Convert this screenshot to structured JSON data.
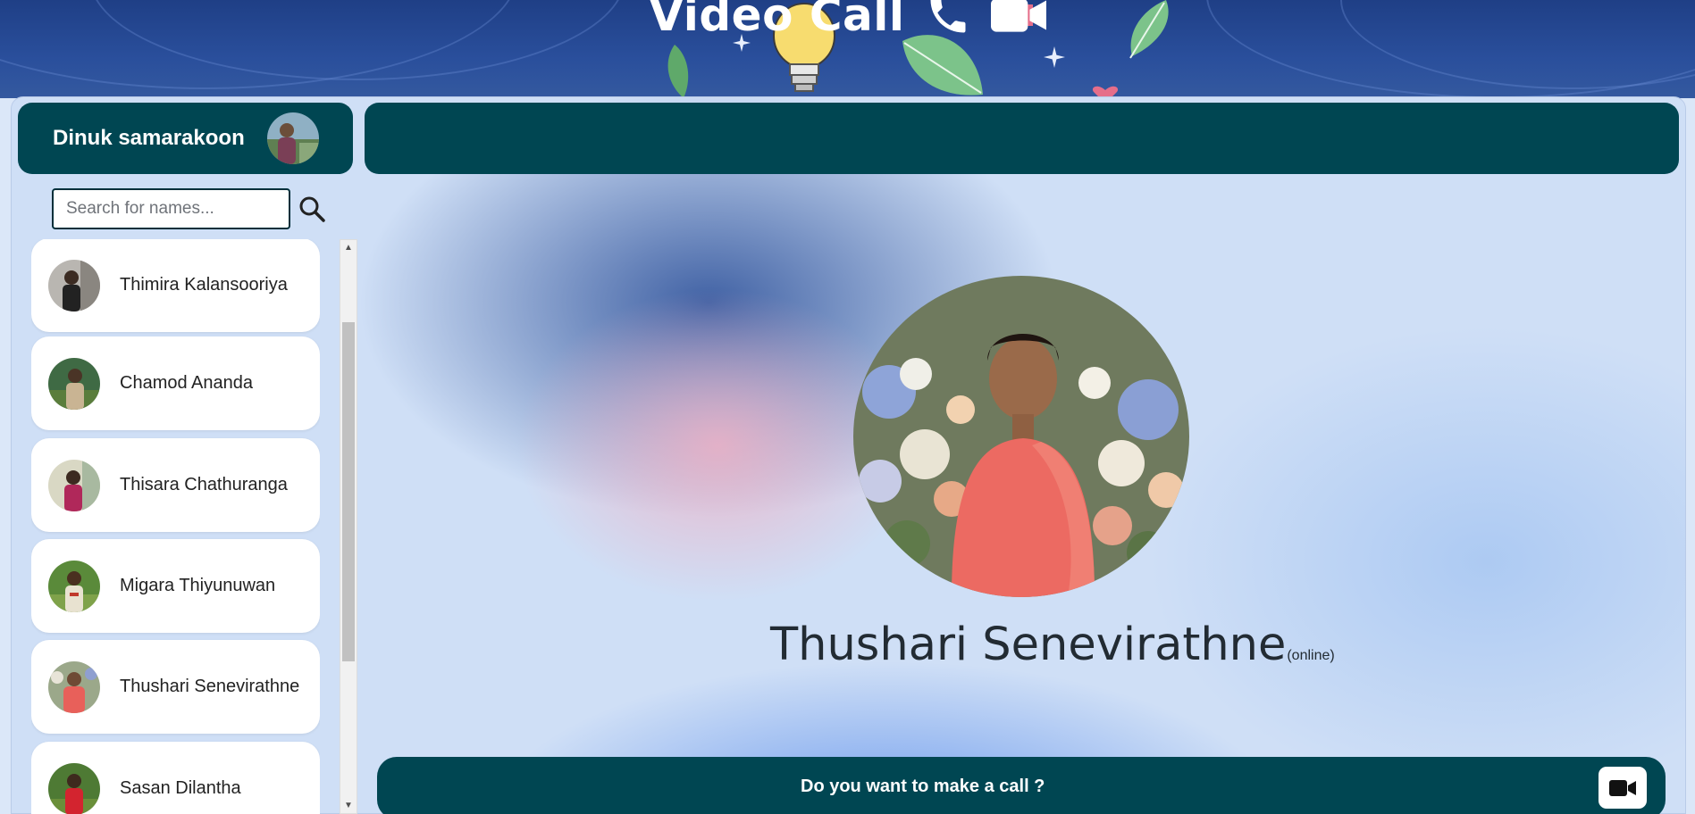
{
  "app": {
    "title": "Video Call",
    "title_icons": [
      "phone-icon",
      "video-camera-icon"
    ]
  },
  "current_user": {
    "name": "Dinuk samarakoon",
    "avatar": "avatar-photo"
  },
  "search": {
    "placeholder": "Search for names...",
    "value": "",
    "button_icon": "search-icon"
  },
  "contacts": [
    {
      "name": "Thimira Kalansooriya",
      "avatar": "avatar-photo"
    },
    {
      "name": "Chamod Ananda",
      "avatar": "avatar-photo"
    },
    {
      "name": "Thisara Chathuranga",
      "avatar": "avatar-photo"
    },
    {
      "name": "Migara Thiyunuwan",
      "avatar": "avatar-photo"
    },
    {
      "name": "Thushari Senevirathne",
      "avatar": "avatar-photo"
    },
    {
      "name": "Sasan Dilantha",
      "avatar": "avatar-photo"
    }
  ],
  "selected_contact": {
    "name": "Thushari Senevirathne",
    "status": "(online)"
  },
  "call_bar": {
    "question": "Do you want to make a call ?",
    "button_icon": "video-camera-icon"
  },
  "colors": {
    "primary_teal": "#004652",
    "banner_blue": "#24478f",
    "card_white": "#ffffff",
    "text_dark": "#222b33"
  }
}
